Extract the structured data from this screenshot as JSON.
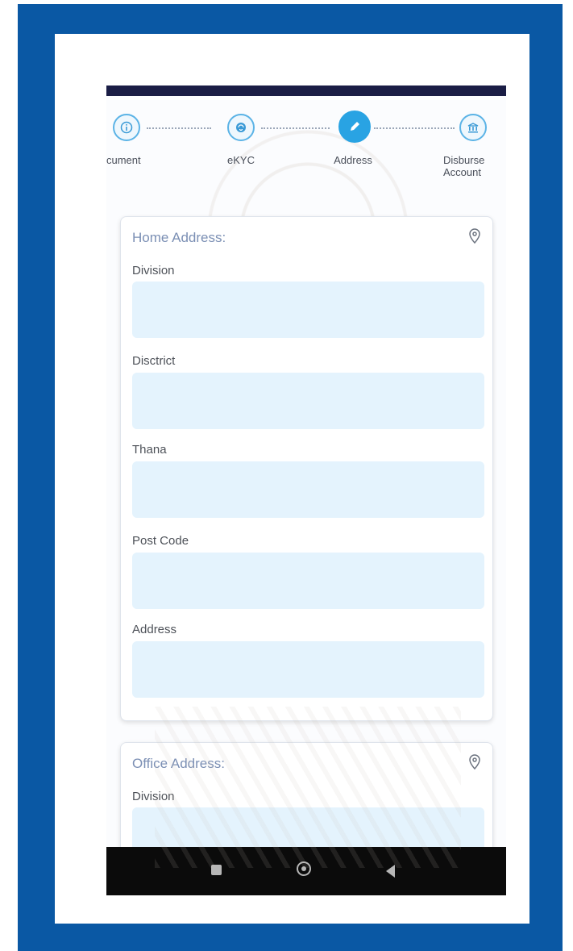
{
  "stepper": {
    "steps": [
      {
        "label": "Document",
        "visible_label": "cument"
      },
      {
        "label": "eKYC",
        "visible_label": "eKYC"
      },
      {
        "label": "Address",
        "visible_label": "Address"
      },
      {
        "label": "Disbursement Account",
        "visible_label": "Disburse\nAccount"
      }
    ],
    "active_step": 3
  },
  "home_address": {
    "title": "Home Address:",
    "fields": [
      {
        "label": "Division",
        "value": ""
      },
      {
        "label": "Disctrict",
        "value": ""
      },
      {
        "label": "Thana",
        "value": ""
      },
      {
        "label": "Post Code",
        "value": ""
      },
      {
        "label": "Address",
        "value": ""
      }
    ]
  },
  "office_address": {
    "title": "Office Address:",
    "fields": [
      {
        "label": "Division",
        "value": ""
      }
    ]
  },
  "colors": {
    "frame": "#0a58a4",
    "accent": "#29a3e3",
    "input_bg": "#e4f3fd",
    "title_text": "#7b8fb4"
  },
  "icons": {
    "step_1": "info-icon",
    "step_2": "fingerprint-icon",
    "step_3": "edit-icon",
    "step_4": "bank-icon",
    "card_pin": "location-pin-icon",
    "nav": [
      "recent-apps-icon",
      "home-icon",
      "back-icon"
    ]
  }
}
